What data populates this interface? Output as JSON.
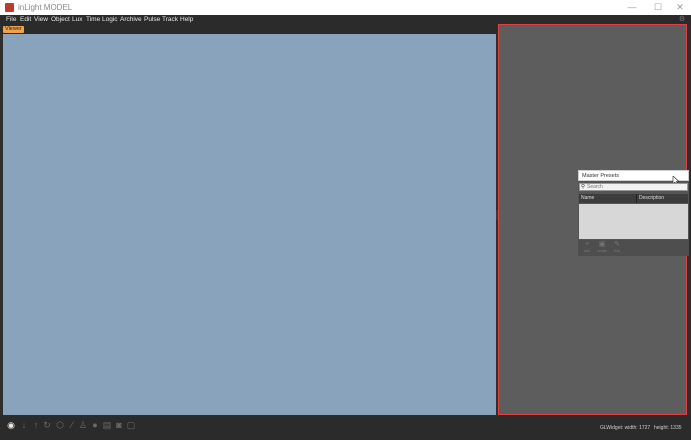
{
  "window": {
    "title": "inLight MODEL",
    "minimize_glyph": "—",
    "maximize_glyph": "☐",
    "close_glyph": "✕"
  },
  "menu": [
    "File",
    "Edit",
    "View",
    "Object",
    "Lux",
    "Time",
    "Logic",
    "Archive",
    "Pulse",
    "Track",
    "Help"
  ],
  "tabs": {
    "viewer": "Viewer"
  },
  "presets": {
    "title": "Master Presets",
    "search_placeholder": "Search",
    "columns": [
      "Name",
      "Description"
    ],
    "toolbar": [
      {
        "icon": "add-icon",
        "glyph": "+",
        "label": "Add"
      },
      {
        "icon": "image-icon",
        "glyph": "▣",
        "label": "Image"
      },
      {
        "icon": "edit-icon",
        "glyph": "✎",
        "label": "Edit"
      }
    ]
  },
  "status": {
    "widget_width": "GLWidget: width: 1727",
    "widget_height": "height: 1335"
  },
  "colors": {
    "viewer_bg": "#8aa3bd",
    "tab_accent": "#f0a24a",
    "panel_border": "#e04040"
  }
}
